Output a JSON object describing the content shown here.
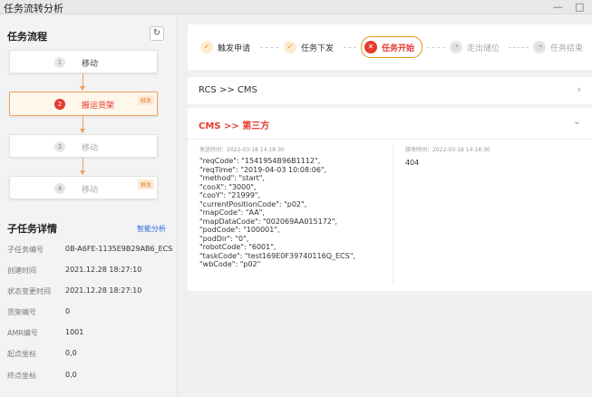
{
  "window": {
    "title": "任务流转分析",
    "minimize": "—",
    "maximize": "□"
  },
  "flow": {
    "title": "任务流程",
    "nodes": [
      {
        "num": "1",
        "label": "移动",
        "tag": "",
        "state": "done"
      },
      {
        "num": "2",
        "label": "搬运货架",
        "tag": "触发",
        "state": "active"
      },
      {
        "num": "3",
        "label": "移动",
        "tag": "",
        "state": "inactive"
      },
      {
        "num": "4",
        "label": "移动",
        "tag": "触发",
        "state": "inactive"
      }
    ]
  },
  "detail": {
    "title": "子任务详情",
    "smart_link": "智能分析",
    "rows": [
      {
        "key": "子任务编号",
        "value": "0B-A6FE-1135E9B29AB6_ECS"
      },
      {
        "key": "创建时间",
        "value": "2021.12.28 18:27:10"
      },
      {
        "key": "状态变更时间",
        "value": "2021.12.28 18:27:10"
      },
      {
        "key": "货架编号",
        "value": "0"
      },
      {
        "key": "AMR编号",
        "value": "1001"
      },
      {
        "key": "起点坐标",
        "value": "0,0"
      },
      {
        "key": "终点坐标",
        "value": "0,0"
      }
    ]
  },
  "steps": [
    {
      "label": "触发申请",
      "state": "done",
      "icon": "✓"
    },
    {
      "label": "任务下发",
      "state": "done",
      "icon": "✓"
    },
    {
      "label": "任务开始",
      "state": "current",
      "icon": "✕"
    },
    {
      "label": "走出储位",
      "state": "pending",
      "icon": "◔"
    },
    {
      "label": "任务结束",
      "state": "pending",
      "icon": "◔"
    }
  ],
  "routes": [
    {
      "label": "RCS  >>  CMS",
      "expanded": false
    },
    {
      "label": "CMS  >>  第三方",
      "expanded": true
    }
  ],
  "payload": {
    "send_time": "发送时间：2022-03-18 14:18:30",
    "recv_time": "接收时间：2022-03-18 14:18:30",
    "request": "\"reqCode\": \"1541954B96B1112\",\n\"reqTime\": \"2019-04-03 10:08:06\",\n\"method\": \"start\",\n\"cooX\": \"3000\",\n\"cooY\": \"21999\",\n\"currentPositionCode\": \"p02\",\n\"mapCode\": \"AA\",\n\"mapDataCode\": \"002069AA015172\",\n\"podCode\": \"100001\",\n\"podDir\": \"0\",\n\"robotCode\": \"6001\",\n\"taskCode\": \"test169E0F39740116Q_ECS\",\n\"wbCode\": \"p02\"",
    "response": "404"
  },
  "colors": {
    "accent": "#e8921c",
    "active": "#e63a2e",
    "link": "#2d6bd6"
  }
}
